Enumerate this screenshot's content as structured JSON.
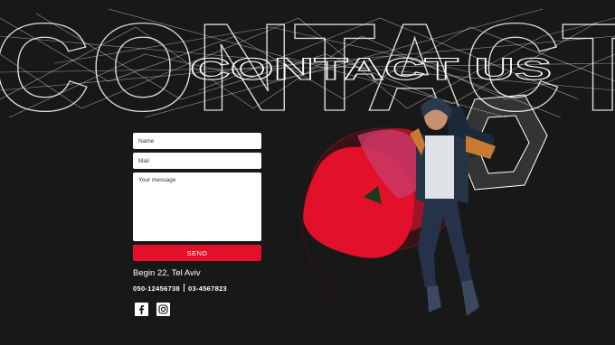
{
  "hero": {
    "big_text": "CONTACT",
    "small_text": "CONTACT US"
  },
  "form": {
    "name_placeholder": "Name",
    "mail_placeholder": "Mail",
    "message_placeholder": "Your message",
    "send_label": "SEND"
  },
  "contact": {
    "address": "Begin 22, Tel Aviv",
    "phone_1": "050-12456738",
    "phone_2": "03-4567823"
  },
  "social": [
    "facebook-icon",
    "instagram-icon"
  ],
  "colors": {
    "background": "#181818",
    "accent": "#e3102a",
    "text": "#ffffff"
  }
}
